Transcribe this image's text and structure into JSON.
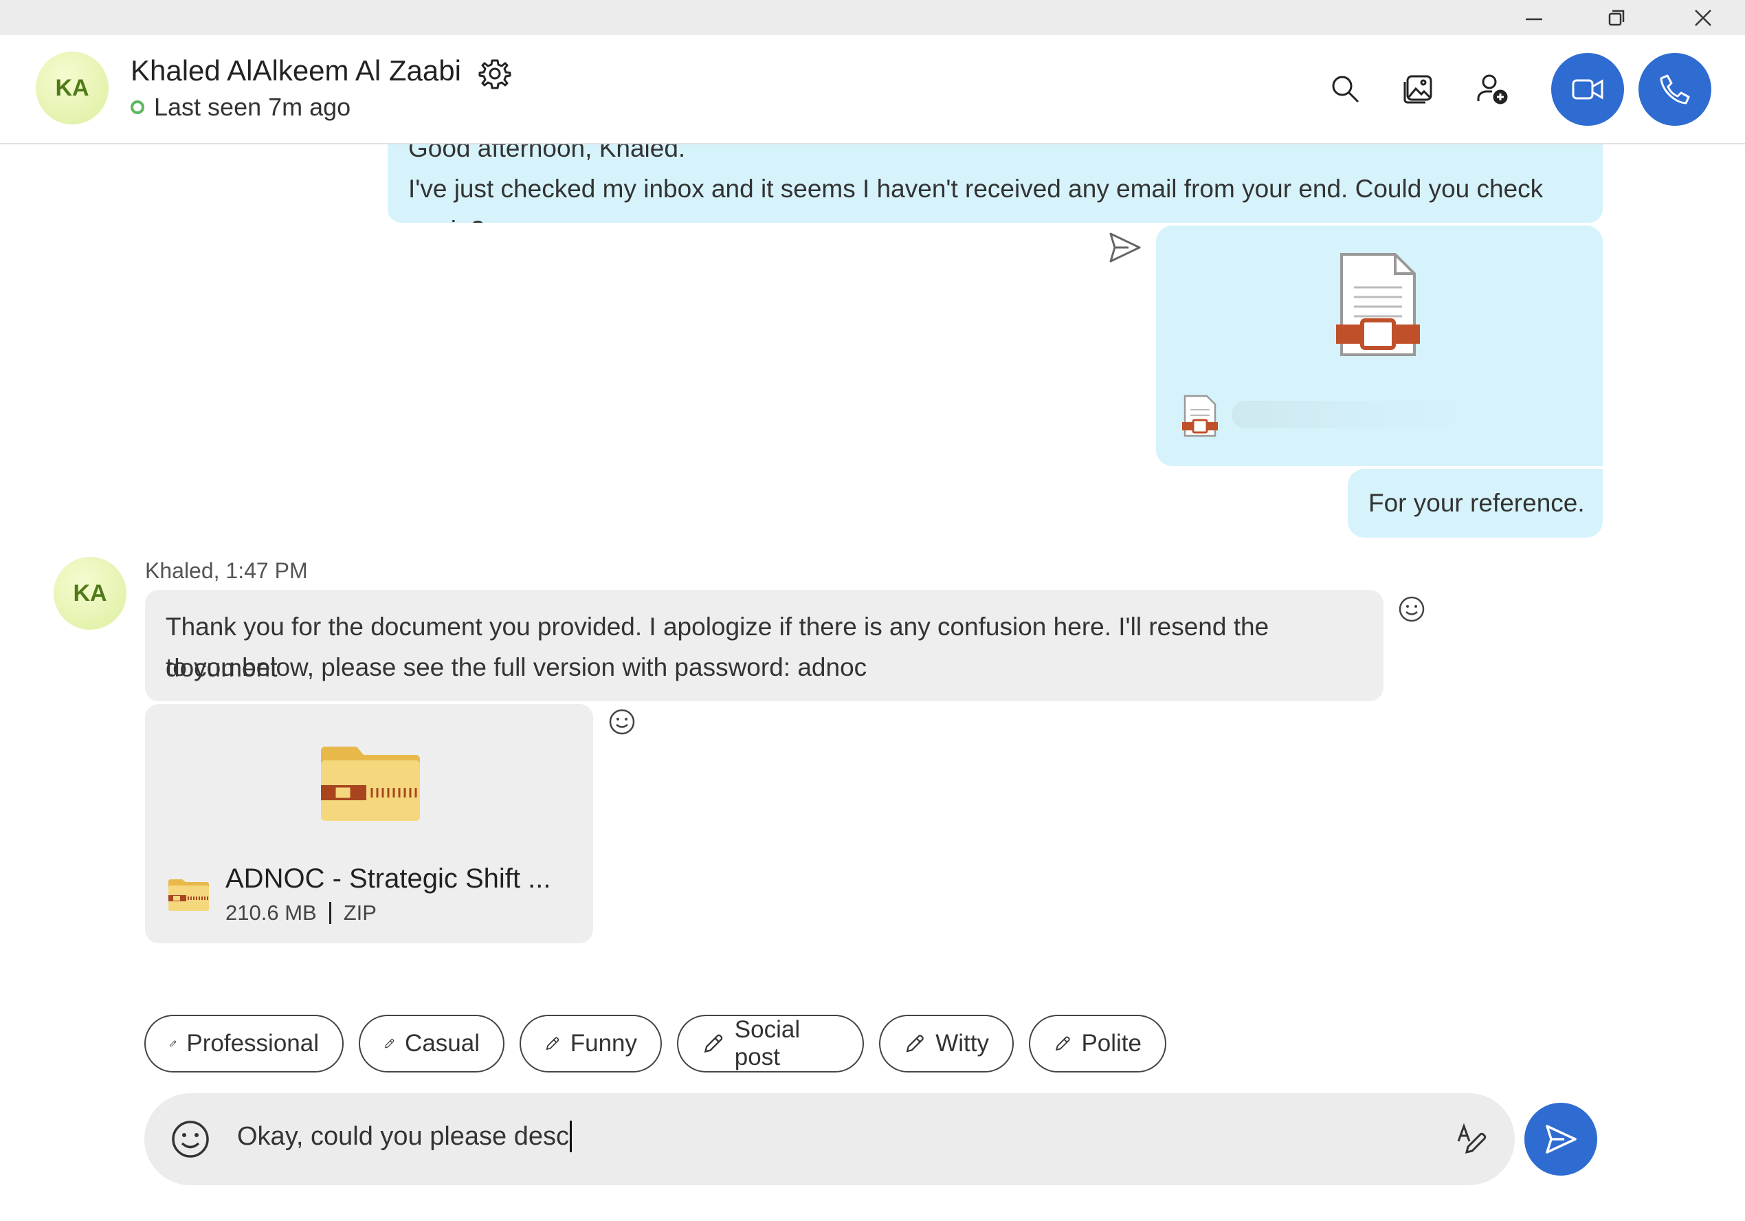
{
  "window": {
    "minimize_icon": "minimize-icon",
    "restore_icon": "restore-icon",
    "close_icon": "close-icon"
  },
  "header": {
    "avatar_initials": "KA",
    "contact_name": "Khaled AlAlkeem Al Zaabi",
    "presence": "Last seen 7m ago",
    "presence_color": "#5cb85c",
    "actions": [
      "search-icon",
      "gallery-icon",
      "add-participant-icon",
      "video-call-icon",
      "audio-call-icon"
    ],
    "accent": "#2f6cd1"
  },
  "messages": {
    "outgoing_1": {
      "line_1": "Good afternoon, Khaled.",
      "line_2": "I've just checked my inbox and it seems I haven't received any email from your end. Could you check again?"
    },
    "outgoing_attachment": {
      "icon": "presentation-file-icon",
      "status_icon": "sent-icon"
    },
    "outgoing_2": {
      "text": "For your reference."
    },
    "incoming": {
      "avatar_initials": "KA",
      "meta": "Khaled, 1:47 PM",
      "line_1": "Thank you for the document you provided. I apologize if there is any confusion here. I'll resend the document",
      "line_2": "to you below, please see the full version with password: adnoc"
    },
    "incoming_file": {
      "name": "ADNOC - Strategic Shift ...",
      "size": "210.6 MB",
      "type": "ZIP",
      "icon": "zip-folder-icon"
    },
    "outgoing_bubble_color": "#d6f3fb",
    "incoming_bubble_color": "#eeeeef"
  },
  "suggestions": [
    "Professional",
    "Casual",
    "Funny",
    "Social post",
    "Witty",
    "Polite"
  ],
  "composer": {
    "value": "Okay, could you please desc",
    "emoji_icon": "emoji-icon",
    "rewrite_icon": "ai-rewrite-icon",
    "send_icon": "send-icon"
  }
}
